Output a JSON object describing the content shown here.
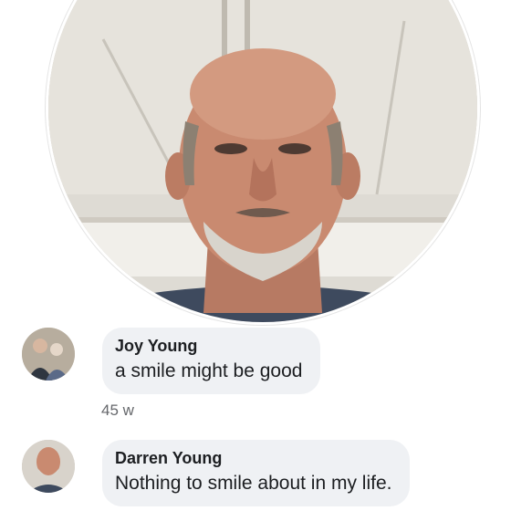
{
  "comments": [
    {
      "author": "Joy Young",
      "text": "a smile might be good",
      "time": "45 w"
    },
    {
      "author": "Darren Young",
      "text": "Nothing to smile about in my life."
    }
  ],
  "colors": {
    "bubble": "#eff1f4",
    "name": "#1c1e21",
    "meta": "#65676b"
  }
}
